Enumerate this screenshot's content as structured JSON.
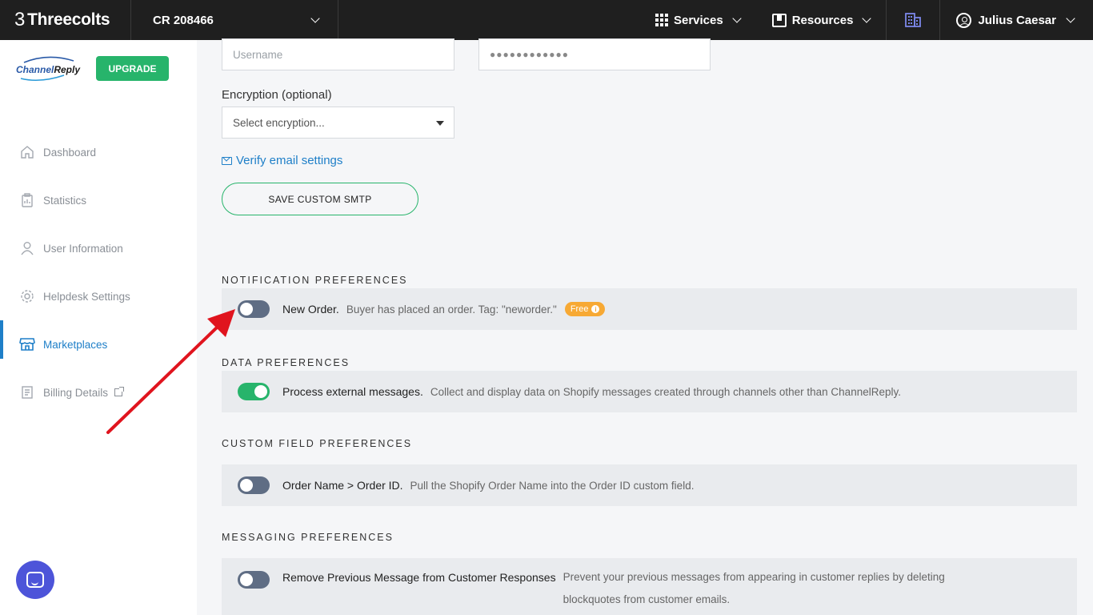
{
  "topbar": {
    "brand": "Threecolts",
    "brand_glyph": "3",
    "account": "CR 208466",
    "services": "Services",
    "resources": "Resources",
    "user": "Julius Caesar"
  },
  "sidebar": {
    "logo_channel": "Channel",
    "logo_reply": "Reply",
    "upgrade": "UPGRADE",
    "items": [
      {
        "label": "Dashboard",
        "icon": "home-icon"
      },
      {
        "label": "Statistics",
        "icon": "clipboard-icon"
      },
      {
        "label": "User Information",
        "icon": "user-icon"
      },
      {
        "label": "Helpdesk Settings",
        "icon": "gear-icon"
      },
      {
        "label": "Marketplaces",
        "icon": "store-icon",
        "active": true
      },
      {
        "label": "Billing Details",
        "icon": "receipt-icon"
      }
    ]
  },
  "smtp": {
    "username_placeholder": "Username",
    "password_value": "●●●●●●●●●●●●",
    "encryption_label": "Encryption (optional)",
    "encryption_placeholder": "Select encryption...",
    "verify_link": "Verify email settings",
    "save_button": "SAVE CUSTOM SMTP"
  },
  "sections": {
    "notification": {
      "title": "NOTIFICATION PREFERENCES",
      "name": "New Order.",
      "desc": "Buyer has placed an order. Tag: \"neworder.\"",
      "badge": "Free",
      "enabled": false
    },
    "data": {
      "title": "DATA PREFERENCES",
      "name": "Process external messages.",
      "desc": "Collect and display data on Shopify messages created through channels other than ChannelReply.",
      "enabled": true
    },
    "custom_field": {
      "title": "CUSTOM FIELD PREFERENCES",
      "name": "Order Name > Order ID.",
      "desc": "Pull the Shopify Order Name into the Order ID custom field.",
      "enabled": false
    },
    "messaging": {
      "title": "MESSAGING PREFERENCES",
      "name": "Remove Previous Message from Customer Responses",
      "desc_line1": "Prevent your previous messages from appearing in customer replies by deleting",
      "desc_line2": "blockquotes from customer emails.",
      "enabled": false
    }
  },
  "colors": {
    "accent_green": "#27b46b",
    "link_blue": "#1e7fc8",
    "arrow_red": "#e0141e",
    "badge_orange": "#f7a934"
  }
}
